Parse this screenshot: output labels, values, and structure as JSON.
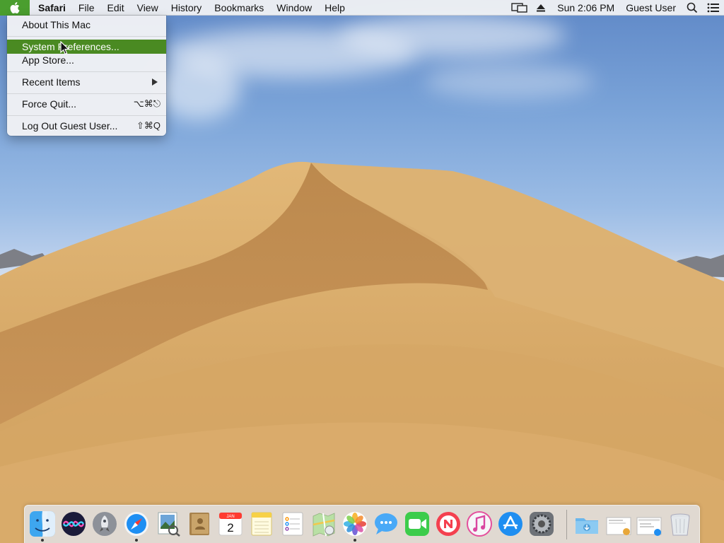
{
  "menubar": {
    "app_name": "Safari",
    "menus": [
      "File",
      "Edit",
      "View",
      "History",
      "Bookmarks",
      "Window",
      "Help"
    ],
    "clock": "Sun 2:06 PM",
    "user": "Guest User",
    "icons": [
      "airplay-icon",
      "eject-icon",
      "spotlight-search-icon",
      "notification-center-icon"
    ]
  },
  "apple_menu": {
    "items": [
      {
        "label": "About This Mac",
        "shortcut": ""
      },
      {
        "label": "System Preferences...",
        "shortcut": "",
        "highlighted": true
      },
      {
        "label": "App Store...",
        "shortcut": ""
      },
      {
        "label": "Recent Items",
        "shortcut": "",
        "submenu": true
      },
      {
        "label": "Force Quit...",
        "shortcut": "⌥⌘⎋"
      },
      {
        "label": "Log Out Guest User...",
        "shortcut": "⇧⌘Q"
      }
    ],
    "highlight_color": "#4a8a22"
  },
  "dock": {
    "apps": [
      {
        "name": "Finder",
        "icon": "finder-icon",
        "running": true
      },
      {
        "name": "Siri",
        "icon": "siri-icon",
        "running": false
      },
      {
        "name": "Launchpad",
        "icon": "launchpad-icon",
        "running": false
      },
      {
        "name": "Safari",
        "icon": "safari-icon",
        "running": true
      },
      {
        "name": "Preview",
        "icon": "preview-icon",
        "running": false
      },
      {
        "name": "Contacts",
        "icon": "contacts-icon",
        "running": false
      },
      {
        "name": "Calendar",
        "icon": "calendar-icon",
        "running": false,
        "month": "JAN",
        "day": "2"
      },
      {
        "name": "Notes",
        "icon": "notes-icon",
        "running": false
      },
      {
        "name": "Reminders",
        "icon": "reminders-icon",
        "running": false
      },
      {
        "name": "Maps",
        "icon": "maps-icon",
        "running": false
      },
      {
        "name": "Photos",
        "icon": "photos-icon",
        "running": true
      },
      {
        "name": "Messages",
        "icon": "messages-icon",
        "running": false
      },
      {
        "name": "FaceTime",
        "icon": "facetime-icon",
        "running": false
      },
      {
        "name": "News",
        "icon": "news-icon",
        "running": false
      },
      {
        "name": "iTunes",
        "icon": "itunes-icon",
        "running": false
      },
      {
        "name": "App Store",
        "icon": "app-store-icon",
        "running": false
      },
      {
        "name": "System Preferences",
        "icon": "system-preferences-icon",
        "running": false
      }
    ],
    "right_items": [
      "downloads-folder-icon",
      "document-stack-icon",
      "screenshot-stack-icon",
      "trash-icon"
    ]
  },
  "colors": {
    "accent": "#4a8a22",
    "menubar_bg": "#eef0f4",
    "sky": "#7aa3d8",
    "sand": "#d9ae6e"
  }
}
